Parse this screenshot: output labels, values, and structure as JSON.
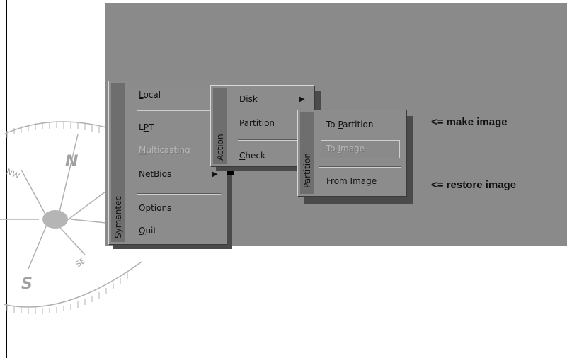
{
  "symantec_menu": {
    "title": "Symantec",
    "items": [
      {
        "prefix": "",
        "underline": "L",
        "rest": "ocal"
      },
      {
        "prefix": "L",
        "underline": "P",
        "rest": "T"
      },
      {
        "prefix": "",
        "underline": "M",
        "rest": "ulticasting"
      },
      {
        "prefix": "",
        "underline": "N",
        "rest": "etBios"
      },
      {
        "prefix": "",
        "underline": "O",
        "rest": "ptions"
      },
      {
        "prefix": "",
        "underline": "Q",
        "rest": "uit"
      }
    ],
    "submenu_arrow": "▶"
  },
  "action_menu": {
    "title": "Action",
    "items": [
      {
        "underline": "D",
        "rest": "isk"
      },
      {
        "underline": "P",
        "rest": "artition"
      },
      {
        "underline": "C",
        "rest": "heck"
      }
    ],
    "submenu_arrow": "▶"
  },
  "partition_menu": {
    "title": "Partition",
    "items": [
      {
        "prefix": "To ",
        "underline": "P",
        "rest": "artition"
      },
      {
        "prefix": "To ",
        "underline": "I",
        "rest": "mage"
      },
      {
        "prefix": "",
        "underline": "F",
        "rest": "rom Image"
      }
    ]
  },
  "annotations": {
    "make": "<= make image",
    "restore": "<= restore image"
  },
  "compass": {
    "n": "N",
    "nw": "NW",
    "s": "S",
    "se": "SE"
  }
}
